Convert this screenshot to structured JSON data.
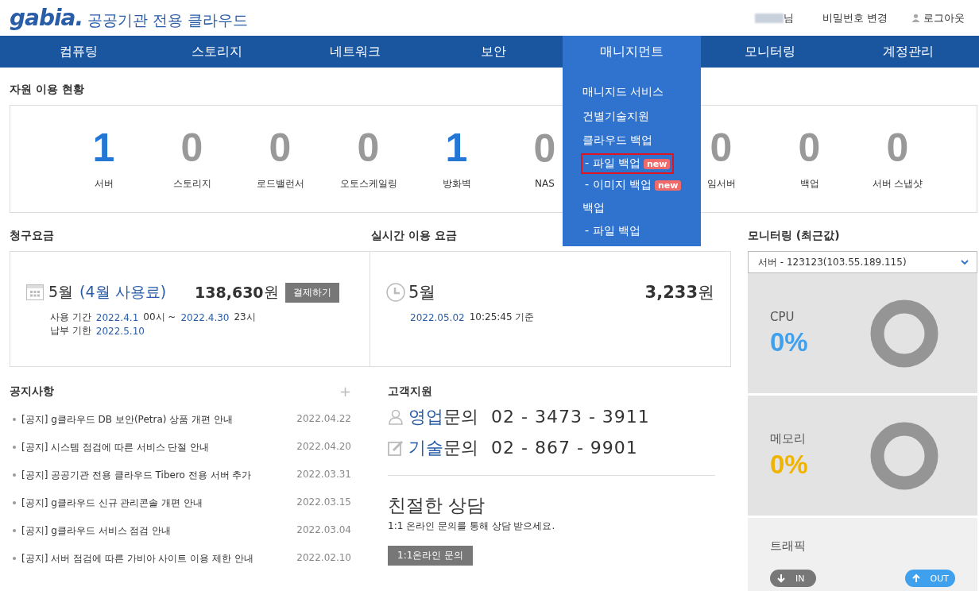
{
  "header": {
    "logo": "gabia.",
    "service_title": "공공기관 전용 클라우드",
    "user_suffix": "님",
    "links": [
      {
        "kind": "text",
        "label": "비밀번호 변경"
      },
      {
        "kind": "user",
        "label": "로그아웃"
      }
    ]
  },
  "nav": [
    {
      "label": "컴퓨팅",
      "selected": false
    },
    {
      "label": "스토리지",
      "selected": false
    },
    {
      "label": "네트워크",
      "selected": false
    },
    {
      "label": "보안",
      "selected": false
    },
    {
      "label": "매니지먼트",
      "selected": true
    },
    {
      "label": "모니터링",
      "selected": false
    },
    {
      "label": "계정관리",
      "selected": false
    }
  ],
  "dropdown": [
    {
      "kind": "item",
      "label": "매니지드 서비스",
      "highlighted": false
    },
    {
      "kind": "item",
      "label": "건별기술지원",
      "highlighted": false
    },
    {
      "kind": "item",
      "label": "클라우드 백업",
      "highlighted": false
    },
    {
      "kind": "sub",
      "label": "- 파일 백업",
      "badge": "new",
      "highlighted": true
    },
    {
      "kind": "sub",
      "label": "- 이미지 백업",
      "badge": "new",
      "highlighted": false
    },
    {
      "kind": "item",
      "label": "백업",
      "highlighted": false
    },
    {
      "kind": "sub",
      "label": "- 파일 백업",
      "highlighted": false
    }
  ],
  "resources": {
    "title": "자원 이용 현황",
    "items": [
      {
        "value": "1",
        "label": "서버",
        "active": true
      },
      {
        "value": "0",
        "label": "스토리지",
        "active": false
      },
      {
        "value": "0",
        "label": "로드밸런서",
        "active": false
      },
      {
        "value": "0",
        "label": "오토스케일링",
        "active": false
      },
      {
        "value": "1",
        "label": "방화벽",
        "active": true
      },
      {
        "value": "0",
        "label": "NAS",
        "active": false
      },
      {
        "value": "0",
        "label": "임서버",
        "active": false
      },
      {
        "value": "0",
        "label": "백업",
        "active": false
      },
      {
        "value": "0",
        "label": "서버 스냅샷",
        "active": false
      }
    ]
  },
  "billing": {
    "title": "청구요금",
    "month": "5월",
    "usage_month": "(4월 사용료)",
    "amount": "138,630",
    "unit": "원",
    "pay_button": "결제하기",
    "details": [
      {
        "label": "사용 기간",
        "value": "2022.4.1",
        "suffix": "00시 ~",
        "value2": "2022.4.30",
        "suffix2": "23시"
      },
      {
        "label": "납부 기한",
        "value": "2022.5.10"
      }
    ]
  },
  "realtime": {
    "title": "실시간 이용 요금",
    "month": "5월",
    "amount": "3,233",
    "unit": "원",
    "date": "2022.05.02",
    "time": "10:25:45 기준"
  },
  "notices": {
    "title": "공지사항",
    "more": "+",
    "items": [
      {
        "title": "[공지] g클라우드 DB 보안(Petra) 상품 개편 안내",
        "date": "2022.04.22"
      },
      {
        "title": "[공지] 시스템 점검에 따른 서비스 단절 안내",
        "date": "2022.04.20"
      },
      {
        "title": "[공지] 공공기관 전용 클라우드 Tibero 전용 서버 추가",
        "date": "2022.03.31"
      },
      {
        "title": "[공지] g클라우드 신규 관리콘솔 개편 안내",
        "date": "2022.03.15"
      },
      {
        "title": "[공지] g클라우드 서비스 점검 안내",
        "date": "2022.03.04"
      },
      {
        "title": "[공지] 서버 점검에 따른 가비아 사이트 이용 제한 안내",
        "date": "2022.02.10"
      }
    ]
  },
  "support": {
    "title": "고객지원",
    "contacts": [
      {
        "kind": "person",
        "accent": "영업",
        "label": "문의",
        "phone": "02 - 3473 - 3911"
      },
      {
        "kind": "edit",
        "accent": "기술",
        "label": "문의",
        "phone": "02 - 867 - 9901"
      }
    ],
    "consult_title": "친절한 상담",
    "consult_text": "1:1 온라인 문의를 통해 상담 받으세요.",
    "consult_button": "1:1온라인 문의"
  },
  "monitoring": {
    "title": "모니터링 (최근값)",
    "server": "서버 - 123123(103.55.189.115)",
    "panels": [
      {
        "kind": "gauge",
        "label": "CPU",
        "value": "0%",
        "color": "#3fa0ee"
      },
      {
        "kind": "gauge",
        "label": "메모리",
        "value": "0%",
        "color": "#f0b400"
      },
      {
        "kind": "traffic",
        "label": "트래픽",
        "in": "IN",
        "out": "OUT"
      }
    ]
  }
}
